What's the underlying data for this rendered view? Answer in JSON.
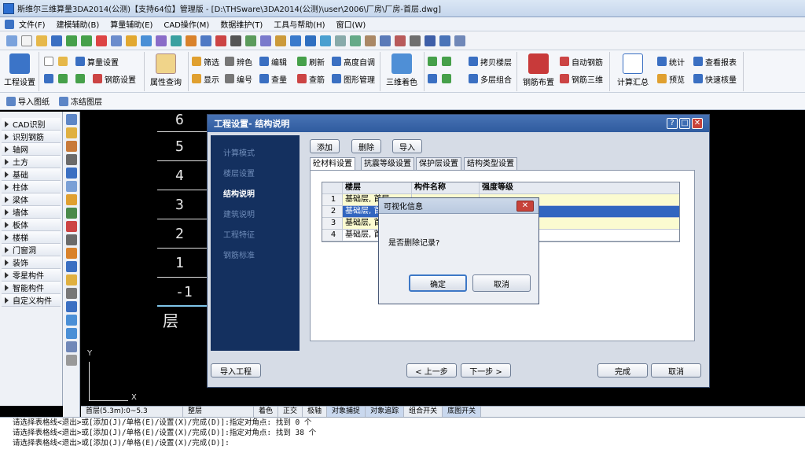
{
  "window": {
    "title": "斯维尔三维算量3DA2014(公测)【支持64位】管理版 - [D:\\THSware\\3DA2014(公测)\\user\\2006\\厂房\\厂房-首层.dwg]"
  },
  "menu": [
    "文件(F)",
    "建模辅助(B)",
    "算量辅助(E)",
    "CAD操作(M)",
    "数据维护(T)",
    "工具与帮助(H)",
    "窗口(W)"
  ],
  "ribbon": {
    "project_settings": "工程设置",
    "calc_settings": "算量设置",
    "rebar_settings": "钢筋设置",
    "property_query": "属性查询",
    "filter": "筛选",
    "edit_color": "辨色",
    "edit": "编辑",
    "refresh": "刷新",
    "height_adjust": "高度自调",
    "show": "显示",
    "number": "编号",
    "check_quantity": "查量",
    "check_rebar": "查筋",
    "graphic_manage": "图形管理",
    "three_d_color": "三维着色",
    "copy_floor": "拷贝楼层",
    "multi_floor": "多层组合",
    "rebar_layout": "钢筋布置",
    "auto_rebar": "自动钢筋",
    "rebar_3d": "钢筋三维",
    "calc_summary": "计算汇总",
    "statistics": "统计",
    "preview": "预览",
    "view_report": "查看报表",
    "quick_check": "快速核量"
  },
  "subtoolbar": [
    "导入图纸",
    "冻结图层"
  ],
  "leftnav": [
    "CAD识别",
    "识别钢筋",
    "轴网",
    "土方",
    "基础",
    "柱体",
    "梁体",
    "墙体",
    "板体",
    "楼梯",
    "门窗洞",
    "装饰",
    "零星构件",
    "智能构件",
    "自定义构件"
  ],
  "canvas": {
    "floors": [
      "6",
      "5",
      "4",
      "3",
      "2",
      "1",
      "-1"
    ],
    "floor_word": "层",
    "axis_x": "X",
    "axis_y": "Y"
  },
  "statusbar": {
    "floor": "首层(5.3m):0~5.3",
    "mode": "整层",
    "toggles": [
      "着色",
      "正交",
      "极轴",
      "对象捕捉",
      "对象追踪",
      "组合开关",
      "底图开关"
    ],
    "active": [
      "对象捕捉",
      "对象追踪",
      "底图开关"
    ]
  },
  "command": [
    "请选择表格线<退出>或[添加(J)/单格(E)/设置(X)/完成(D)]:指定对角点: 找到 0 个",
    "请选择表格线<退出>或[添加(J)/单格(E)/设置(X)/完成(D)]:指定对角点: 找到 38 个",
    "请选择表格线<退出>或[添加(J)/单格(E)/设置(X)/完成(D)]:"
  ],
  "dialog": {
    "title": "工程设置- 结构说明",
    "steps": [
      "计算模式",
      "楼层设置",
      "结构说明",
      "建筑说明",
      "工程特征",
      "钢筋标准"
    ],
    "active_step": "结构说明",
    "buttons": {
      "add": "添加",
      "delete": "删除",
      "import": "导入"
    },
    "tabs": [
      "砼材料设置",
      "抗震等级设置",
      "保护层设置",
      "结构类型设置"
    ],
    "active_tab": "砼材料设置",
    "grid": {
      "columns": [
        "楼层",
        "构件名称",
        "强度等级"
      ],
      "rows": [
        {
          "no": "1",
          "floor": "基础层, 首层",
          "name": "",
          "grade": ""
        },
        {
          "no": "2",
          "floor": "基础层, 首层",
          "name": "",
          "grade": ""
        },
        {
          "no": "3",
          "floor": "基础层, 首层",
          "name": "",
          "grade": ""
        },
        {
          "no": "4",
          "floor": "基础层, 首层",
          "name": "",
          "grade": ""
        }
      ]
    },
    "footer": {
      "import_project": "导入工程",
      "prev": "< 上一步",
      "next": "下一步 >",
      "finish": "完成",
      "cancel": "取消"
    }
  },
  "msgbox": {
    "title": "可视化信息",
    "text": "是否删除记录?",
    "ok": "确定",
    "cancel": "取消"
  }
}
